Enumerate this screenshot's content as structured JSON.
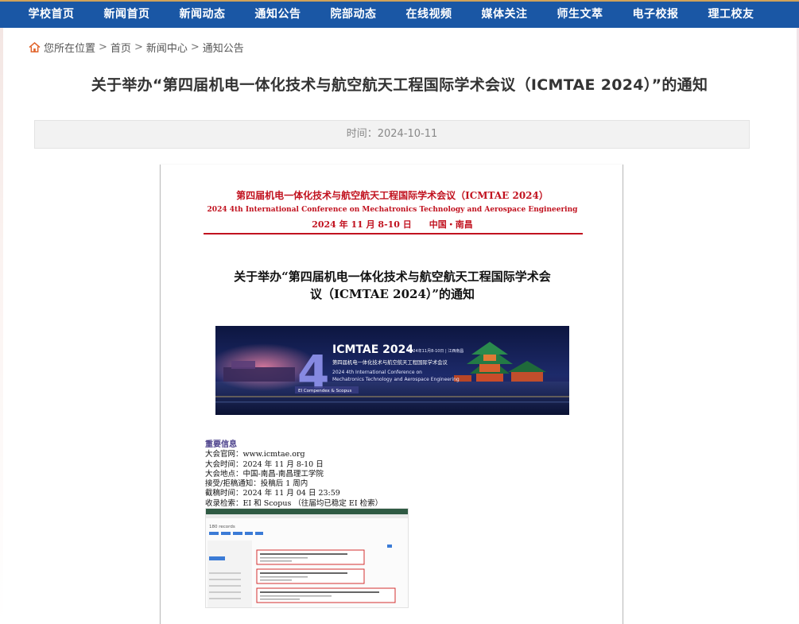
{
  "nav": {
    "items": [
      "学校首页",
      "新闻首页",
      "新闻动态",
      "通知公告",
      "院部动态",
      "在线视频",
      "媒体关注",
      "师生文萃",
      "电子校报",
      "理工校友"
    ]
  },
  "breadcrumb": {
    "prefix": "您所在位置",
    "items": [
      "首页",
      "新闻中心",
      "通知公告"
    ],
    "sep": ">"
  },
  "article": {
    "title": "关于举办“第四届机电一体化技术与航空航天工程国际学术会议（ICMTAE 2024）”的通知",
    "time": "时间：2024-10-11"
  },
  "doc": {
    "head_cn": "第四届机电一体化技术与航空航天工程国际学术会议（ICMTAE 2024）",
    "head_en": "2024 4th International Conference on Mechatronics Technology and Aerospace Engineering",
    "head_date": "2024 年 11 月 8-10 日　　中国・南昌",
    "title_line1": "关于举办“第四届机电一体化技术与航空航天工程国际学术会",
    "title_line2": "议（ICMTAE 2024）”的通知",
    "banner": {
      "big_number": "4",
      "acronym": "ICMTAE 2024",
      "date_place": "2024年11月8-10日 | 江西南昌",
      "cn_name": "第四届机电一体化技术与航空航天工程国际学术会议",
      "en_line1": "2024 4th International Conference on",
      "en_line2": "Mechatronics Technology and Aerospace Engineering",
      "index_tag": "EI Compendex & Scopus"
    },
    "info": {
      "heading": "重要信息",
      "lines": [
        "大会官网：www.icmtae.org",
        "大会时间：2024 年 11 月 8-10 日",
        "大会地点：中国-南昌-南昌理工学院",
        "接受/拒稿通知：投稿后 1 周内",
        "截稿时间：2024 年 11 月 04 日 23:59",
        "收录检索：EI 和 Scopus （往届均已稳定 EI 检索）"
      ]
    },
    "screenshot": {
      "records": "180 records"
    }
  },
  "colors": {
    "nav_bg": "#1a57a5",
    "doc_red": "#c1121f",
    "info_heading": "#4a3f8a"
  }
}
